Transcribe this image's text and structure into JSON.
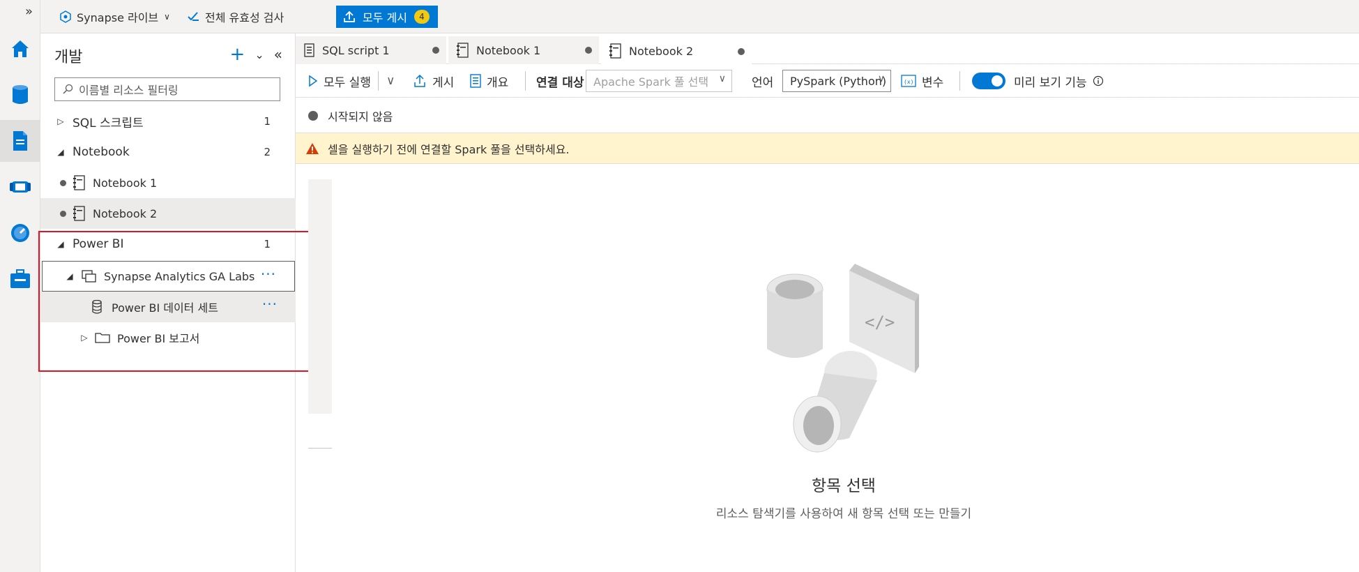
{
  "rail": {
    "items": [
      {
        "name": "home-icon",
        "color": "#0078d4"
      },
      {
        "name": "data-icon",
        "color": "#0078d4"
      },
      {
        "name": "develop-icon",
        "color": "#0078d4"
      },
      {
        "name": "integrate-icon",
        "color": "#0078d4"
      },
      {
        "name": "monitor-icon",
        "color": "#0078d4"
      },
      {
        "name": "manage-icon",
        "color": "#0078d4"
      }
    ]
  },
  "topbar": {
    "synapse_live": "Synapse 라이브",
    "validate_all": "전체 유효성 검사",
    "publish_all": "모두 게시",
    "publish_count": "4"
  },
  "panel": {
    "title": "개발",
    "filter_placeholder": "이름별 리소스 필터링",
    "sql_scripts": {
      "label": "SQL 스크립트",
      "count": "1"
    },
    "notebook": {
      "label": "Notebook",
      "count": "2"
    },
    "notebook_items": [
      "Notebook 1",
      "Notebook 2"
    ],
    "powerbi": {
      "label": "Power BI",
      "count": "1"
    },
    "workspace": "Synapse Analytics GA Labs",
    "dataset": "Power BI 데이터 세트",
    "reports": "Power BI 보고서"
  },
  "tabs": [
    "SQL script 1",
    "Notebook 1",
    "Notebook 2"
  ],
  "toolbar": {
    "run_all": "모두 실행",
    "publish": "게시",
    "outline": "개요",
    "attach_to": "연결 대상",
    "spark_pool_placeholder": "Apache Spark 풀 선택",
    "language_label": "언어",
    "language_value": "PySpark (Python)",
    "variables": "변수",
    "preview_features": "미리 보기 기능"
  },
  "status": {
    "text": "시작되지 않음",
    "warning": "셀을 실행하기 전에 연결할 Spark 풀을 선택하세요."
  },
  "empty_state": {
    "title": "항목 선택",
    "subtitle": "리소스 탐색기를 사용하여 새 항목 선택 또는 만들기"
  }
}
